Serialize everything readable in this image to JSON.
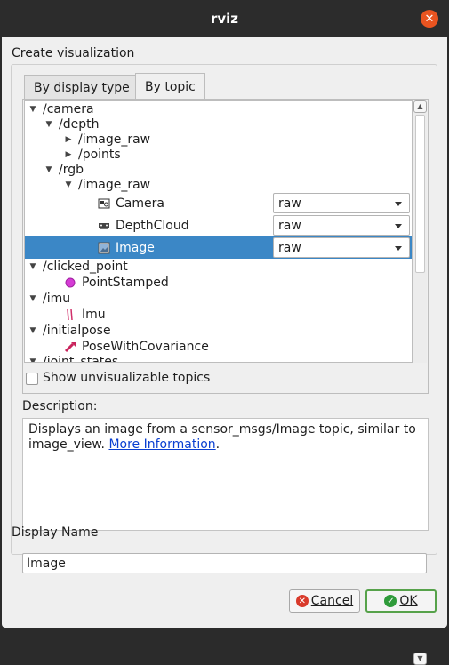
{
  "window": {
    "title": "rviz"
  },
  "group_title": "Create visualization",
  "tabs": [
    {
      "label": "By display type",
      "active": false
    },
    {
      "label": "By topic",
      "active": true
    }
  ],
  "tree": {
    "rows": [
      {
        "label": "/camera",
        "expander": "expanded"
      },
      {
        "label": "/depth",
        "expander": "expanded"
      },
      {
        "label": "/image_raw",
        "expander": "collapsed"
      },
      {
        "label": "/points",
        "expander": "collapsed"
      },
      {
        "label": "/rgb",
        "expander": "expanded"
      },
      {
        "label": "/image_raw",
        "expander": "expanded"
      },
      {
        "label": "Camera",
        "icon": "camera-icon",
        "combo": "raw"
      },
      {
        "label": "DepthCloud",
        "icon": "depthcloud-icon",
        "combo": "raw"
      },
      {
        "label": "Image",
        "icon": "image-icon",
        "combo": "raw",
        "selected": true
      },
      {
        "label": "/clicked_point",
        "expander": "expanded"
      },
      {
        "label": "PointStamped",
        "icon": "point-stamped-icon"
      },
      {
        "label": "/imu",
        "expander": "expanded"
      },
      {
        "label": "Imu",
        "icon": "imu-icon"
      },
      {
        "label": "/initialpose",
        "expander": "expanded"
      },
      {
        "label": "PoseWithCovariance",
        "icon": "pose-icon"
      },
      {
        "label": "/joint_states",
        "expander": "expanded"
      }
    ]
  },
  "show_unvisualizable": {
    "label": "Show unvisualizable topics",
    "checked": false
  },
  "description": {
    "label": "Description:",
    "text": "Displays an image from a sensor_msgs/Image topic, similar to image_view.",
    "link": "More Information",
    "trailing": "."
  },
  "display_name": {
    "label": "Display Name",
    "value": "Image"
  },
  "buttons": {
    "cancel": "Cancel",
    "ok": "OK"
  },
  "colors": {
    "selection": "#3b87c6",
    "ok_border": "#56a24a",
    "cancel_icon": "#d93a2b",
    "ok_icon": "#2e9b3a",
    "link": "#0a3fd1"
  }
}
